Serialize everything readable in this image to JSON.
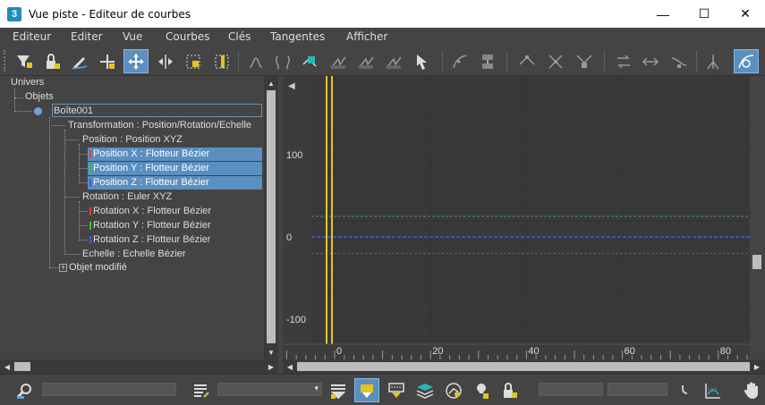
{
  "window": {
    "app_icon_label": "3",
    "title": "Vue piste - Editeur de courbes",
    "minimize_glyph": "—",
    "maximize_glyph": "☐",
    "close_glyph": "✕"
  },
  "menu": [
    "Editeur",
    "Editer",
    "Vue",
    "Courbes",
    "Clés",
    "Tangentes",
    "Afficher"
  ],
  "toolbar": {
    "buttons": [
      "filter-icon",
      "lock-icon",
      "pencil-curve-icon",
      "add-key-icon",
      "move-keys-icon",
      "slide-keys-icon",
      "scale-keys-icon",
      "scale-values-icon",
      "soft-select-icon",
      "tangent-auto-icon",
      "tangent-spline-icon",
      "tangent-fast-icon",
      "tangent-slow-icon",
      "tangent-step-icon",
      "tangent-linear-icon",
      "select-arrow-icon",
      "snap-frames-icon",
      "show-keys-icon",
      "break-tangents-icon",
      "unify-tangents-icon",
      "lock-tangents-icon",
      "param-curve-out-icon",
      "reduce-keys-icon",
      "ease-curve-icon",
      "multiplier-curve-icon",
      "view-toggle-icon"
    ],
    "active": [
      "move-keys-icon",
      "view-toggle-icon"
    ]
  },
  "tree": {
    "nodes": [
      {
        "label": "Univers"
      },
      {
        "label": "Objets"
      },
      {
        "label": "Boîte001"
      },
      {
        "label": "Transformation : Position/Rotation/Echelle"
      },
      {
        "label": "Position : Position XYZ"
      },
      {
        "label": "Position X : Flotteur Bézier",
        "color": "#e03c3c",
        "selected": true
      },
      {
        "label": "Position Y : Flotteur Bézier",
        "color": "#3cc43c",
        "selected": true
      },
      {
        "label": "Position Z : Flotteur Bézier",
        "color": "#3c5ce0",
        "selected": true
      },
      {
        "label": "Rotation : Euler XYZ"
      },
      {
        "label": "Rotation X : Flotteur Bézier",
        "color": "#e03c3c"
      },
      {
        "label": "Rotation Y : Flotteur Bézier",
        "color": "#3cc43c"
      },
      {
        "label": "Rotation Z : Flotteur Bézier",
        "color": "#3c5ce0"
      },
      {
        "label": "Echelle : Echelle Bézier"
      },
      {
        "label": "Objet modifié"
      }
    ],
    "expander_plus": "+"
  },
  "graph": {
    "y_axis_labels": [
      {
        "value": 100,
        "label": "100"
      },
      {
        "value": 0,
        "label": "0"
      },
      {
        "value": -100,
        "label": "-100"
      }
    ],
    "x_axis_labels": [
      {
        "frame": 0,
        "label": "0"
      },
      {
        "frame": 20,
        "label": "20"
      },
      {
        "frame": 40,
        "label": "40"
      },
      {
        "frame": 60,
        "label": "60"
      },
      {
        "frame": 80,
        "label": "80"
      }
    ],
    "curves": [
      {
        "name": "position-x",
        "color": "#c04040",
        "value": -20
      },
      {
        "name": "position-y",
        "color": "#4a9a4a",
        "value": 25
      },
      {
        "name": "position-z",
        "color": "#3c5cf0",
        "value": 0
      }
    ],
    "time_slider_frame": 0,
    "collapse_arrow": "◀",
    "colors": {
      "time_slider": "#e6c41e",
      "background": "#3c3c3c",
      "active_range": "#393939"
    }
  },
  "bottombar": {
    "buttons": [
      "zoom-selected-icon",
      "edit-object-icon",
      "filter-selected-icon",
      "filter-animated-icon",
      "filter-curve-icon",
      "show-visible-icon",
      "filter-controllers-icon",
      "lock-selection-icon",
      "key-stats-icon",
      "pan-hand-icon"
    ],
    "active": [
      "filter-animated-icon"
    ],
    "dropdown_arrow": "▾"
  }
}
